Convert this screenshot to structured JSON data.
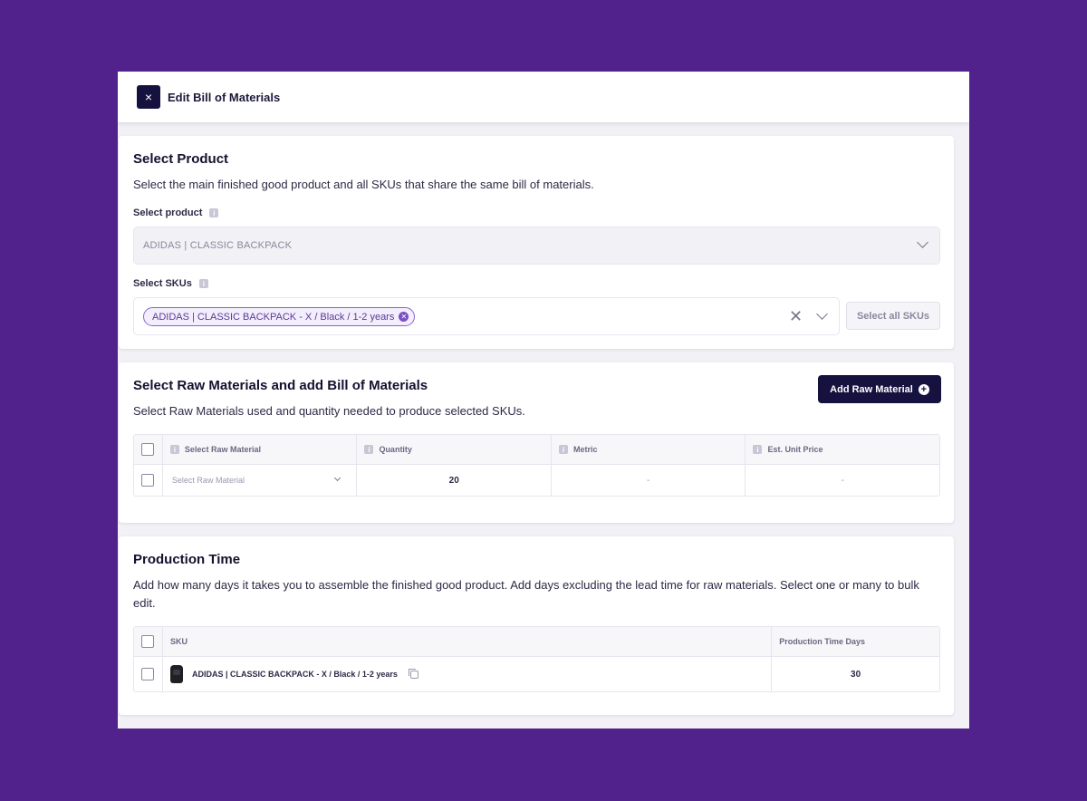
{
  "modal": {
    "title": "Edit Bill of Materials",
    "close_glyph": "×"
  },
  "product_section": {
    "title": "Select Product",
    "description": "Select the main finished good product and all SKUs that share the same bill of materials.",
    "product_label": "Select product",
    "product_value": "ADIDAS | CLASSIC BACKPACK",
    "skus_label": "Select SKUs",
    "selected_sku_chip": "ADIDAS | CLASSIC BACKPACK - X / Black / 1-2 years",
    "select_all_label": "Select all SKUs"
  },
  "raw_materials_section": {
    "title": "Select Raw Materials and add Bill of Materials",
    "description": "Select Raw Materials used and quantity needed to produce selected SKUs.",
    "add_button_label": "Add Raw Material",
    "columns": [
      "Select Raw Material",
      "Quantity",
      "Metric",
      "Est. Unit Price"
    ],
    "rows": [
      {
        "raw_material": "Select Raw Material",
        "quantity": "20",
        "metric": "-",
        "unit_price": "-"
      }
    ]
  },
  "production_section": {
    "title": "Production Time",
    "description": "Add how many days it takes you to assemble the finished good product. Add days excluding the lead time for raw materials. Select one or many to bulk edit.",
    "columns": [
      "SKU",
      "Production Time Days"
    ],
    "rows": [
      {
        "sku": "ADIDAS | CLASSIC BACKPACK - X / Black / 1-2 years",
        "days": "30"
      }
    ]
  },
  "icons": {
    "info": "info-icon",
    "chevron": "chevron-down-icon",
    "clear": "clear-icon",
    "plus": "plus-circle-icon",
    "copy": "copy-icon"
  },
  "colors": {
    "page_background": "#51218c",
    "primary_dark": "#16123f",
    "chip_accent": "#7b4fc4"
  }
}
